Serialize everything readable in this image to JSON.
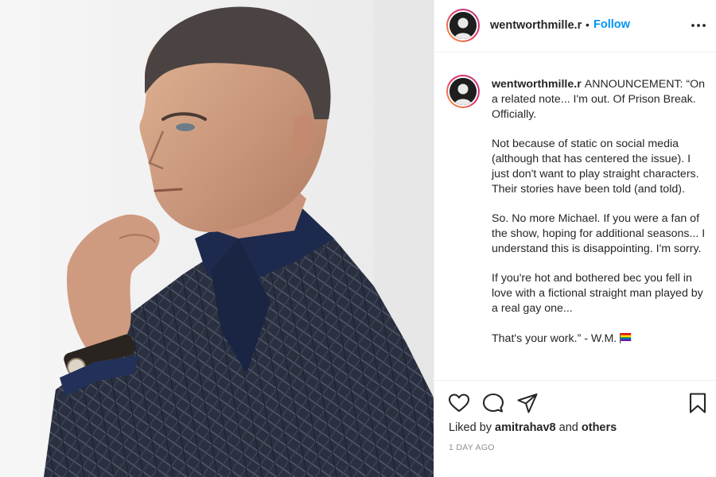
{
  "post": {
    "username": "wentworthmille.r",
    "dot": "•",
    "follow_label": "Follow",
    "more_icon": "more-options-icon",
    "caption_user": "wentworthmille.r",
    "caption_lines": [
      "ANNOUNCEMENT: “On a related note... I'm out. Of Prison Break. Officially.",
      "Not because of static on social media (although that has centered the issue). I just don't want to play straight characters. Their stories have been told (and told).",
      "So. No more Michael. If you were a fan of the show, hoping for additional seasons... I understand this is disappointing. I'm sorry.",
      "If you're hot and bothered bec you fell in love with a fictional straight man played by a real gay one...",
      "That's your work.” - W.M."
    ],
    "caption_emoji": "rainbow-flag-icon",
    "liked_by_prefix": "Liked by",
    "liked_by_user": "amitrahav8",
    "liked_by_and": "and",
    "liked_by_others": "others",
    "timestamp": "1 DAY AGO"
  },
  "icons": {
    "like": "heart-icon",
    "comment": "comment-icon",
    "share": "send-icon",
    "save": "bookmark-icon"
  },
  "colors": {
    "link_blue": "#0095f6",
    "text": "#262626",
    "muted": "#8e8e8e",
    "border": "#efefef"
  }
}
